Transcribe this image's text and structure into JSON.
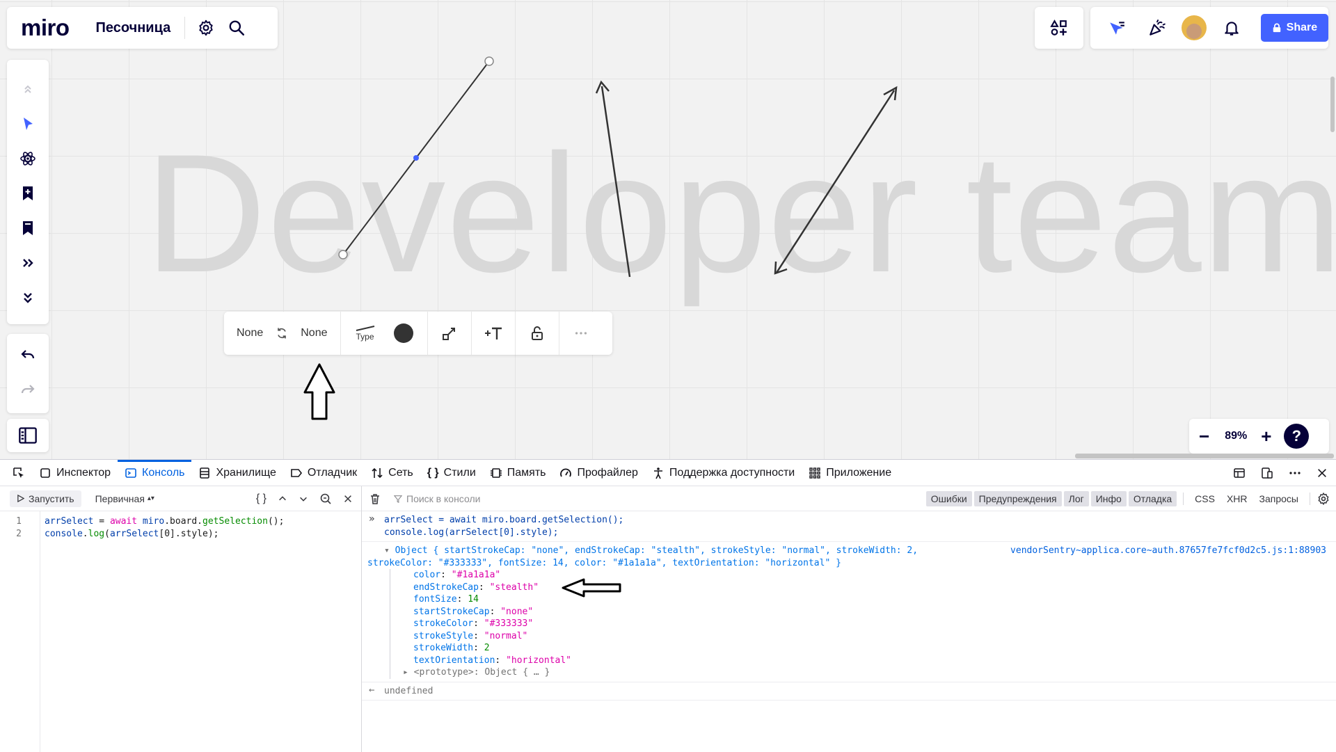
{
  "app": {
    "logo": "miro",
    "board_name": "Песочница",
    "share_label": "Share",
    "accent": "#4262ff"
  },
  "canvas": {
    "watermark_text": "Developer team"
  },
  "left_toolbar": {
    "tools": [
      "collapse-up-icon",
      "select-icon",
      "atom-icon",
      "bookmark-add-icon",
      "bookmark-icon",
      "chevrons-right-icon",
      "chevrons-down-icon"
    ],
    "history": [
      "undo-icon",
      "redo-icon"
    ]
  },
  "context_menu": {
    "start_cap": "None",
    "end_cap": "None",
    "type_label": "Type"
  },
  "zoom": {
    "level": "89%",
    "minus": "−",
    "plus": "+",
    "help": "?"
  },
  "devtools": {
    "tabs": [
      "Инспектор",
      "Консоль",
      "Хранилище",
      "Отладчик",
      "Сеть",
      "Стили",
      "Память",
      "Профайлер",
      "Поддержка доступности",
      "Приложение"
    ],
    "active_tab": "Консоль",
    "editor": {
      "run_label": "Запустить",
      "mode_label": "Первичная",
      "braces": "{ }",
      "line_numbers": [
        "1",
        "2"
      ],
      "line1": {
        "a": "arrSelect",
        "b": " = ",
        "c": "await",
        "d": " miro",
        "e": ".board.",
        "f": "getSelection",
        "g": "();"
      },
      "line2": {
        "a": "console",
        "b": ".",
        "c": "log",
        "d": "(",
        "e": "arrSelect",
        "f": "[0].style);"
      }
    },
    "console": {
      "filter_placeholder": "Поиск в консоли",
      "filters": [
        "Ошибки",
        "Предупреждения",
        "Лог",
        "Инфо",
        "Отладка"
      ],
      "extra_filters": [
        "CSS",
        "XHR",
        "Запросы"
      ],
      "input_line1": "arrSelect = await miro.board.getSelection();",
      "input_line2": "console.log(arrSelect[0].style);",
      "summary_line1_a": "Object { ",
      "summary_line1_b": "startStrokeCap: \"none\", endStrokeCap: \"stealth\", strokeStyle: \"normal\", strokeWidth: 2,",
      "summary_line2": "strokeColor: \"#333333\", fontSize: 14, color: \"#1a1a1a\", textOrientation: \"horizontal\" }",
      "source": "vendorSentry~applica.core~auth.87657fe7fcf0d2c5.js:1:88903",
      "props": [
        {
          "k": "color",
          "v": "\"#1a1a1a\""
        },
        {
          "k": "endStrokeCap",
          "v": "\"stealth\""
        },
        {
          "k": "fontSize",
          "v": "14"
        },
        {
          "k": "startStrokeCap",
          "v": "\"none\""
        },
        {
          "k": "strokeColor",
          "v": "\"#333333\""
        },
        {
          "k": "strokeStyle",
          "v": "\"normal\""
        },
        {
          "k": "strokeWidth",
          "v": "2"
        },
        {
          "k": "textOrientation",
          "v": "\"horizontal\""
        }
      ],
      "prototype_line": "<prototype>: Object { … }",
      "result": "undefined"
    }
  }
}
